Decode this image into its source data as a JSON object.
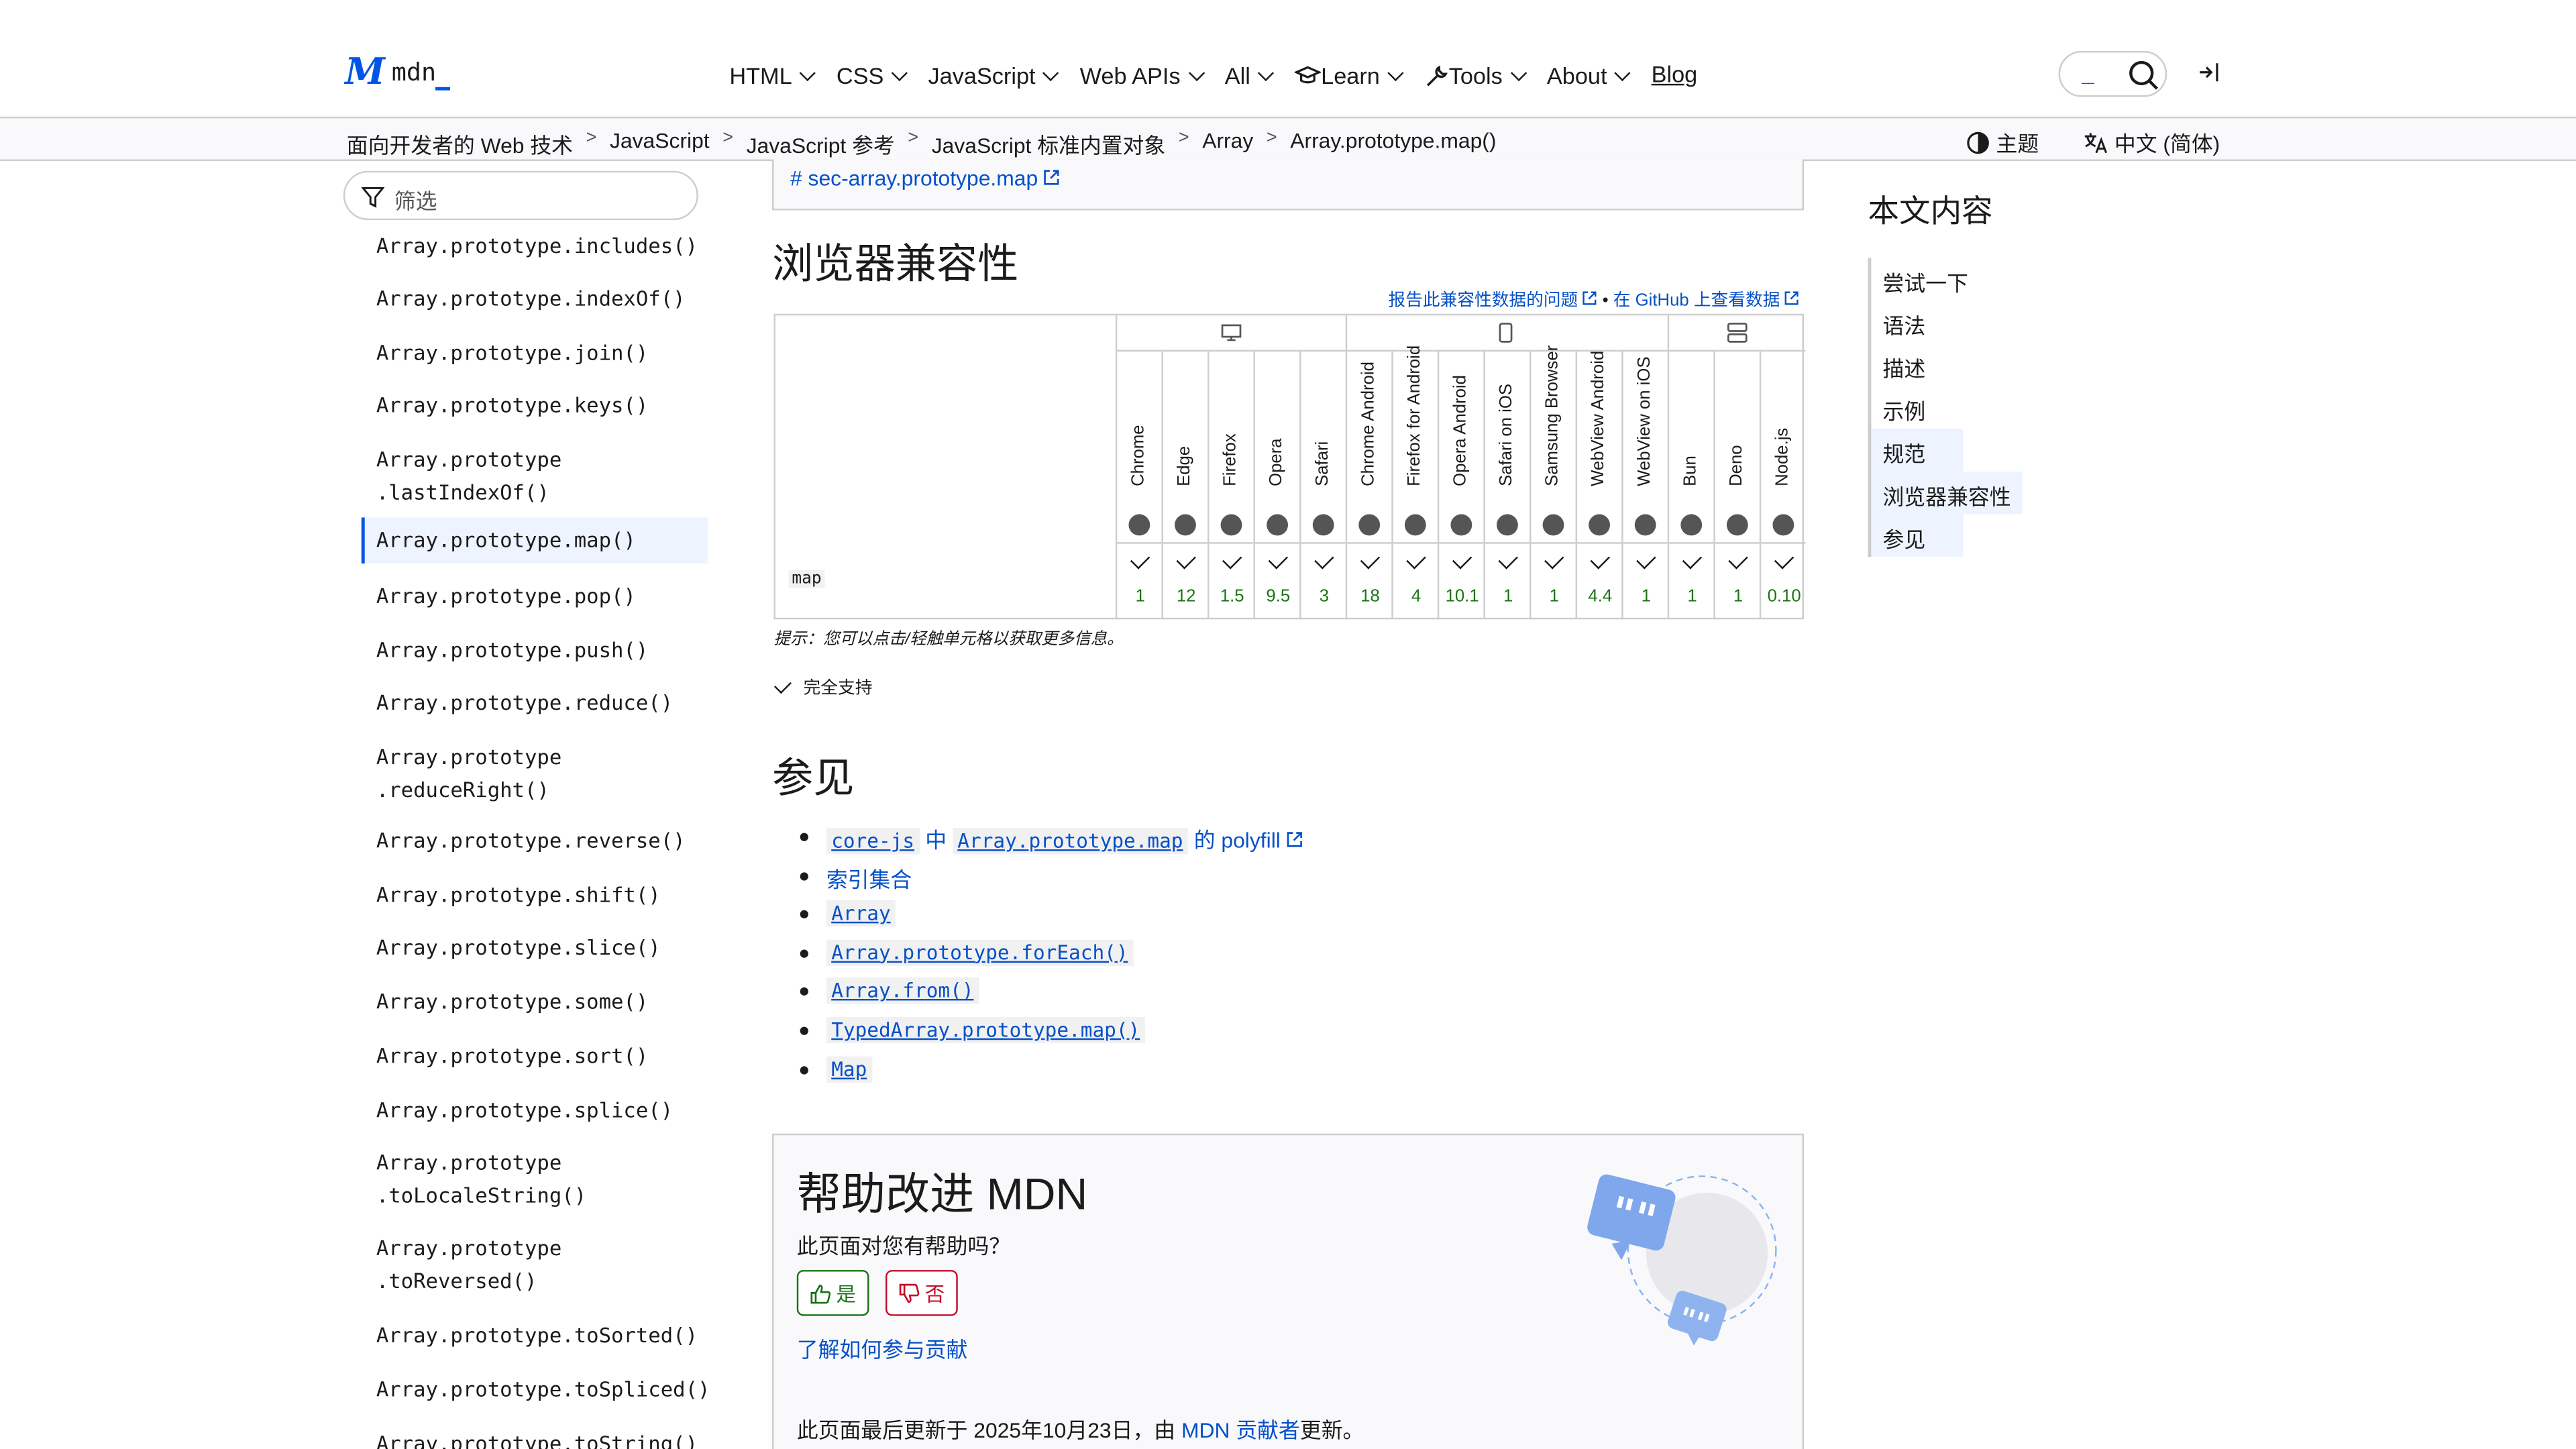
{
  "header": {
    "logo_text": "mdn",
    "nav": [
      "HTML",
      "CSS",
      "JavaScript",
      "Web APIs",
      "All",
      "Learn",
      "Tools",
      "About"
    ],
    "blog": "Blog",
    "search_cursor": "_"
  },
  "breadcrumbs": [
    "面向开发者的 Web 技术",
    "JavaScript",
    "JavaScript 参考",
    "JavaScript 标准内置对象",
    "Array",
    "Array.prototype.map()"
  ],
  "theme_label": "主题",
  "language_label": "中文 (简体)",
  "sidebar": {
    "filter_placeholder": "筛选",
    "items": [
      "Array.prototype.includes()",
      "Array.prototype.indexOf()",
      "Array.prototype.join()",
      "Array.prototype.keys()",
      "Array.prototype\n.lastIndexOf()",
      "Array.prototype.map()",
      "Array.prototype.pop()",
      "Array.prototype.push()",
      "Array.prototype.reduce()",
      "Array.prototype\n.reduceRight()",
      "Array.prototype.reverse()",
      "Array.prototype.shift()",
      "Array.prototype.slice()",
      "Array.prototype.some()",
      "Array.prototype.sort()",
      "Array.prototype.splice()",
      "Array.prototype\n.toLocaleString()",
      "Array.prototype\n.toReversed()",
      "Array.prototype.toSorted()",
      "Array.prototype.toSpliced()",
      "Array.prototype.toString()"
    ],
    "active_index": 5
  },
  "main": {
    "spec_link": "# sec-array.prototype.map",
    "compat_heading": "浏览器兼容性",
    "report_link": "报告此兼容性数据的问题",
    "github_link": "在 GitHub 上查看数据",
    "bullet": "•",
    "feature": "map",
    "browsers": [
      {
        "name": "Chrome",
        "version": "1"
      },
      {
        "name": "Edge",
        "version": "12"
      },
      {
        "name": "Firefox",
        "version": "1.5"
      },
      {
        "name": "Opera",
        "version": "9.5"
      },
      {
        "name": "Safari",
        "version": "3"
      },
      {
        "name": "Chrome Android",
        "version": "18"
      },
      {
        "name": "Firefox for Android",
        "version": "4"
      },
      {
        "name": "Opera Android",
        "version": "10.1"
      },
      {
        "name": "Safari on iOS",
        "version": "1"
      },
      {
        "name": "Samsung Browser",
        "version": "1"
      },
      {
        "name": "WebView Android",
        "version": "4.4"
      },
      {
        "name": "WebView on iOS",
        "version": "1"
      },
      {
        "name": "Bun",
        "version": "1"
      },
      {
        "name": "Deno",
        "version": "1"
      },
      {
        "name": "Node.js",
        "version": "0.10"
      }
    ],
    "tip": "提示：您可以点击/轻触单元格以获取更多信息。",
    "legend_full": "完全支持",
    "see_also_heading": "参见",
    "see_also": [
      {
        "parts": [
          "core-js",
          " 中 ",
          "Array.prototype.map",
          " 的 polyfill"
        ]
      },
      {
        "text": "索引集合"
      },
      {
        "code": "Array"
      },
      {
        "code": "Array.prototype.forEach()"
      },
      {
        "code": "Array.from()"
      },
      {
        "code": "TypedArray.prototype.map()"
      },
      {
        "code": "Map"
      }
    ]
  },
  "help": {
    "title": "帮助改进 MDN",
    "question": "此页面对您有帮助吗？",
    "yes": "是",
    "no": "否",
    "learn": "了解如何参与贡献",
    "updated_prefix": "此页面最后更新于 2025年10月23日，由 ",
    "updated_link": "MDN 贡献者",
    "updated_suffix": "更新。"
  },
  "toc": {
    "heading": "本文内容",
    "items": [
      "尝试一下",
      "语法",
      "描述",
      "示例",
      "规范",
      "浏览器兼容性",
      "参见"
    ]
  },
  "colors": {
    "accent": "#0055e6",
    "link": "#0550c7",
    "supported": "#1a7315"
  }
}
